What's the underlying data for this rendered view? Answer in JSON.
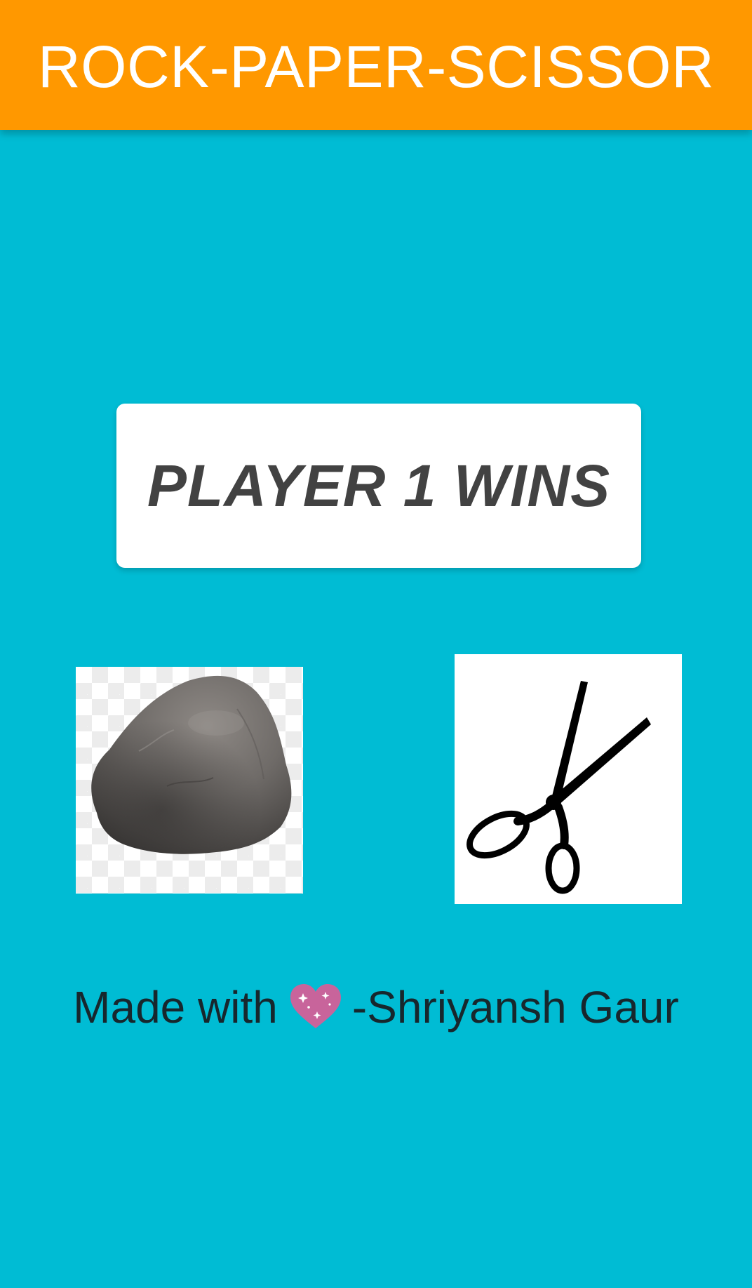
{
  "app_bar": {
    "title": "ROCK-PAPER-SCISSOR",
    "color": "#FF9800"
  },
  "result": {
    "text": "PLAYER 1 WINS"
  },
  "players": [
    {
      "choice": "rock",
      "icon": "rock-image"
    },
    {
      "choice": "scissor",
      "icon": "scissors-icon"
    }
  ],
  "footer": {
    "prefix": "Made with",
    "icon": "sparkling-heart-icon",
    "suffix": "-Shriyansh Gaur"
  },
  "colors": {
    "background": "#00BCD4",
    "card": "#FFFFFF",
    "result_text": "#424242",
    "heart": "#C8649B"
  }
}
